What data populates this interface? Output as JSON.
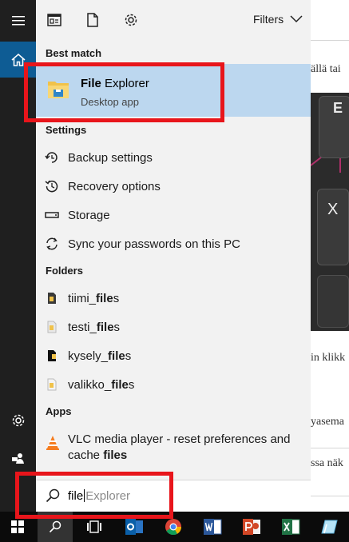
{
  "toolbar": {
    "filters_label": "Filters"
  },
  "sections": {
    "best_match": "Best match",
    "settings": "Settings",
    "folders": "Folders",
    "apps": "Apps"
  },
  "best_match": {
    "title_bold": "File",
    "title_rest": " Explorer",
    "subtitle": "Desktop app"
  },
  "settings_items": [
    {
      "label": "Backup settings",
      "icon": "backup-icon"
    },
    {
      "label": "Recovery options",
      "icon": "recovery-icon"
    },
    {
      "label": "Storage",
      "icon": "storage-icon"
    },
    {
      "label": "Sync your passwords on this PC",
      "icon": "sync-icon"
    }
  ],
  "folder_items": [
    {
      "prefix": "tiimi_",
      "bold": "file",
      "suffix": "s"
    },
    {
      "prefix": "testi_",
      "bold": "file",
      "suffix": "s"
    },
    {
      "prefix": "kysely_",
      "bold": "file",
      "suffix": "s"
    },
    {
      "prefix": "valikko_",
      "bold": "file",
      "suffix": "s"
    }
  ],
  "app_item": {
    "line_text": "VLC media player - reset preferences and cache ",
    "bold": "files"
  },
  "search": {
    "typed": "file",
    "suggestion": "Explorer"
  },
  "background_doc": {
    "snippets": [
      "ällä tai",
      "in klikk",
      "yasema",
      "ssa näk"
    ]
  },
  "photo_keys": {
    "key_a": "E",
    "key_b": "X"
  },
  "colors": {
    "accent": "#0e5c94",
    "highlight": "#bcd7ef",
    "annotation": "#e8151b"
  }
}
